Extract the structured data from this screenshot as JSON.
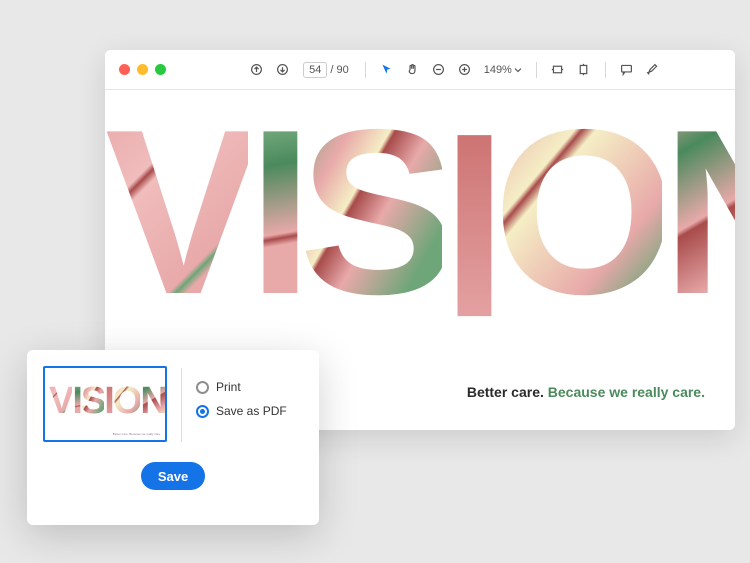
{
  "toolbar": {
    "page_current": "54",
    "page_total": "90",
    "zoom": "149%"
  },
  "canvas": {
    "vision_text": "VISION",
    "tagline_bold": "Better care.",
    "tagline_accent": "Because we really care."
  },
  "dialog": {
    "option_print": "Print",
    "option_pdf": "Save as PDF",
    "save_label": "Save",
    "selected": "pdf"
  }
}
